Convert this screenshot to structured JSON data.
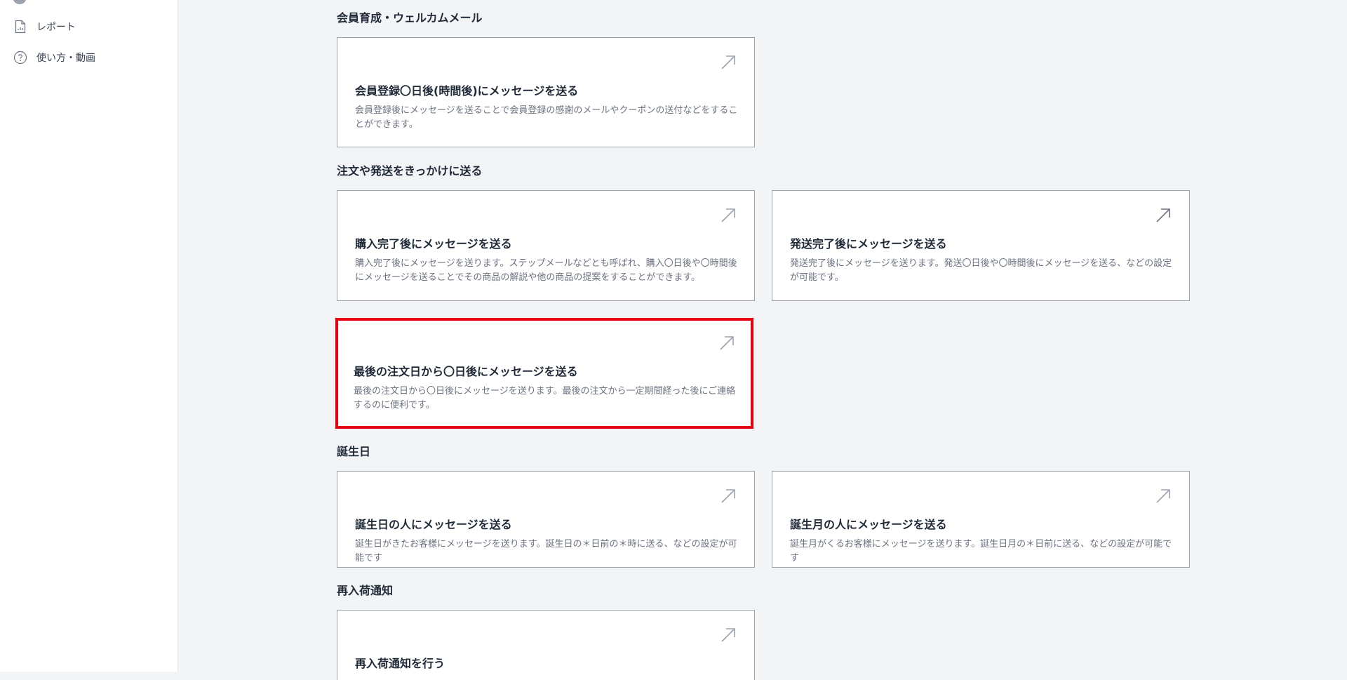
{
  "sidebar": {
    "items": [
      {
        "label": "レポート",
        "icon": "report-document-icon"
      },
      {
        "label": "使い方・動画",
        "icon": "help-circle-icon"
      }
    ]
  },
  "sections": [
    {
      "heading": "会員育成・ウェルカムメール",
      "cards": [
        {
          "title": "会員登録〇日後(時間後)にメッセージを送る",
          "description": "会員登録後にメッセージを送ることで会員登録の感謝のメールやクーポンの送付などをすることができます。",
          "icon": "arrow-up-right-icon"
        }
      ]
    },
    {
      "heading": "注文や発送をきっかけに送る",
      "cards": [
        {
          "title": "購入完了後にメッセージを送る",
          "description": "購入完了後にメッセージを送ります。ステップメールなどとも呼ばれ、購入〇日後や〇時間後にメッセージを送ることでその商品の解説や他の商品の提案をすることができます。",
          "icon": "arrow-up-right-icon"
        },
        {
          "title": "発送完了後にメッセージを送る",
          "description": "発送完了後にメッセージを送ります。発送〇日後や〇時間後にメッセージを送る、などの設定が可能です。",
          "icon": "arrow-up-right-icon"
        },
        {
          "title": "最後の注文日から〇日後にメッセージを送る",
          "description": "最後の注文日から〇日後にメッセージを送ります。最後の注文から一定期間経った後にご連絡するのに便利です。",
          "icon": "arrow-up-right-icon",
          "highlight_color": "#e60012"
        }
      ]
    },
    {
      "heading": "誕生日",
      "cards": [
        {
          "title": "誕生日の人にメッセージを送る",
          "description": "誕生日がきたお客様にメッセージを送ります。誕生日の＊日前の＊時に送る、などの設定が可能です",
          "icon": "arrow-up-right-icon"
        },
        {
          "title": "誕生月の人にメッセージを送る",
          "description": "誕生月がくるお客様にメッセージを送ります。誕生日月の＊日前に送る、などの設定が可能です",
          "icon": "arrow-up-right-icon"
        }
      ]
    },
    {
      "heading": "再入荷通知",
      "cards": [
        {
          "title": "再入荷通知を行う",
          "description": "",
          "icon": "arrow-up-right-icon"
        }
      ]
    }
  ]
}
